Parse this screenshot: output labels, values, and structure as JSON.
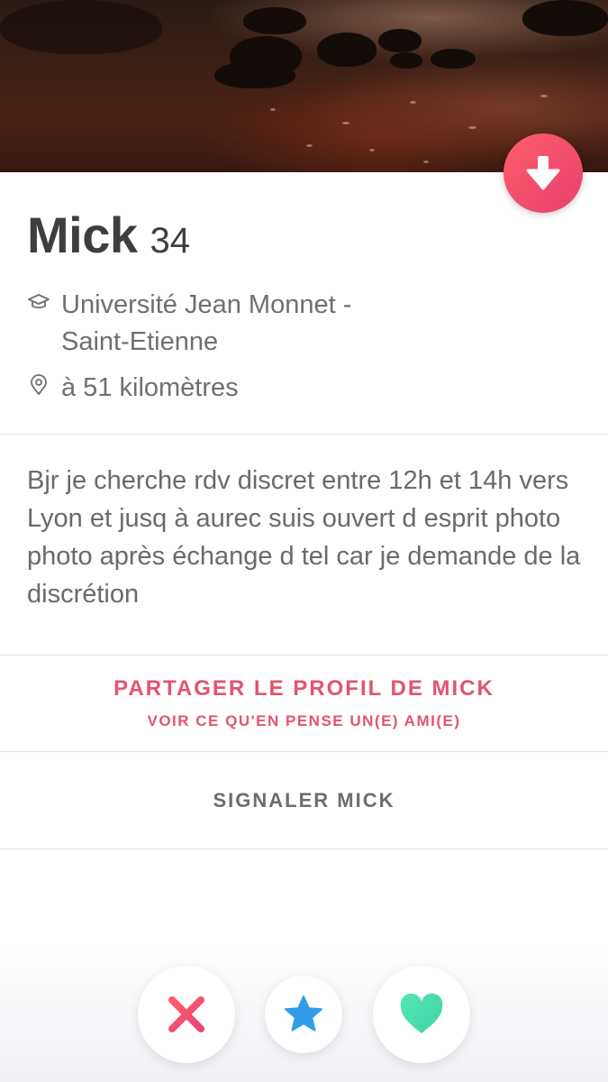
{
  "profile": {
    "name": "Mick",
    "age": "34",
    "school_line1": "Université Jean Monnet -",
    "school_line2": "Saint-Etienne",
    "distance": "à 51 kilomètres",
    "bio": "Bjr je cherche rdv discret entre 12h et 14h vers Lyon et jusq à aurec suis ouvert d esprit photo photo après échange d tel car je demande de la discrétion"
  },
  "share": {
    "title": "PARTAGER LE PROFIL DE MICK",
    "subtitle": "VOIR CE QU'EN PENSE UN(E) AMI(E)"
  },
  "report": {
    "label": "SIGNALER MICK"
  },
  "icons": {
    "down": "arrow-down-icon",
    "school": "graduation-cap-icon",
    "location": "location-pin-icon",
    "nope": "x-icon",
    "super_like": "star-icon",
    "like": "heart-icon"
  },
  "colors": {
    "accent": "#e3546d",
    "down_button_start": "#fd5d6a",
    "down_button_end": "#e8406f",
    "nope_start": "#fd5d6a",
    "nope_end": "#e84676",
    "star": "#2f9de8",
    "like_start": "#55e6b1",
    "like_end": "#3fd2a8",
    "text_dark": "#3e3e3e",
    "text_muted": "#6f6f6f"
  }
}
